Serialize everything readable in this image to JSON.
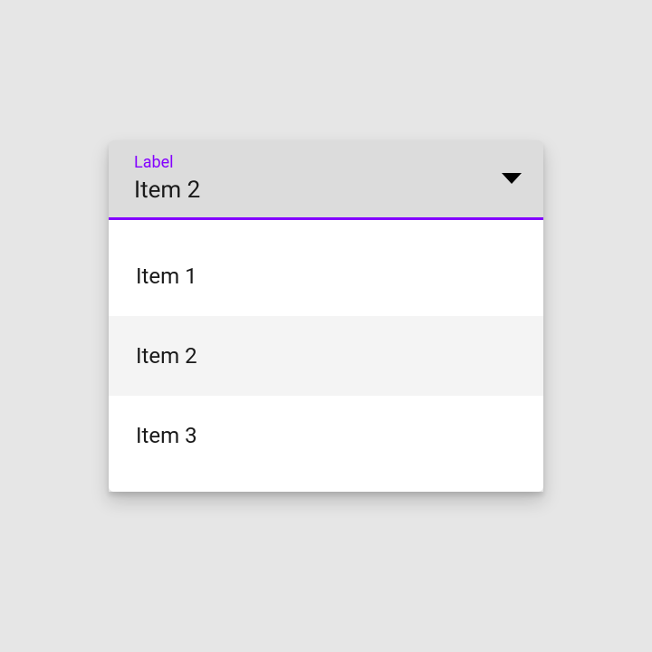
{
  "dropdown": {
    "label": "Label",
    "selected_value": "Item 2",
    "options": [
      {
        "label": "Item 1",
        "selected": false
      },
      {
        "label": "Item 2",
        "selected": true
      },
      {
        "label": "Item 3",
        "selected": false
      }
    ]
  }
}
